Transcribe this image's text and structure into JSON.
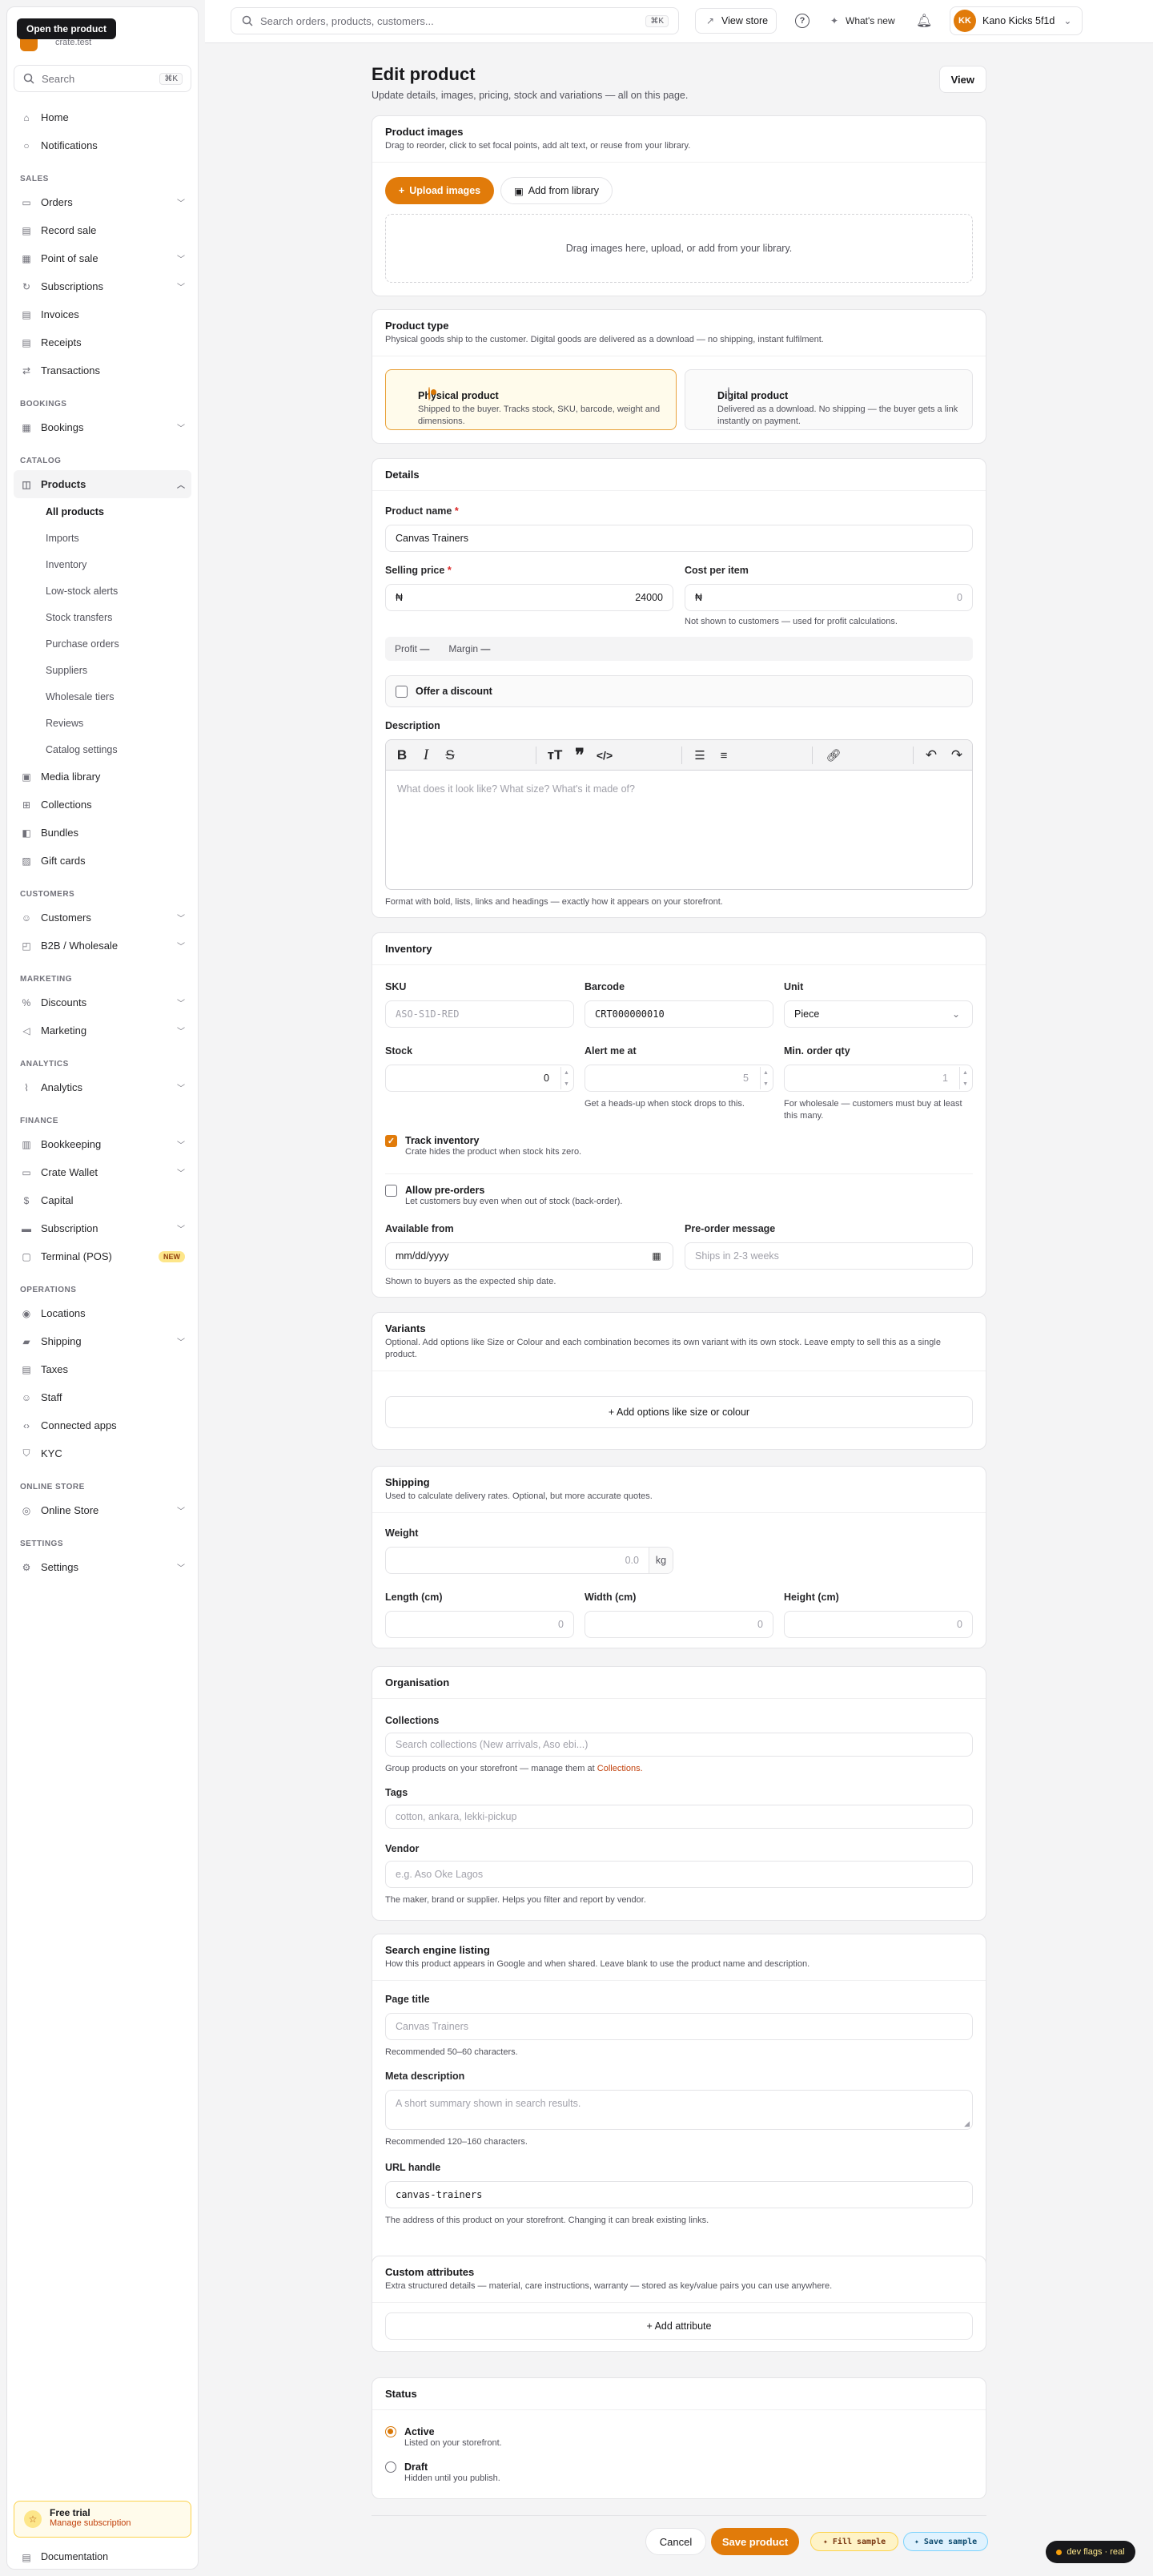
{
  "tooltip": "Open the product",
  "brand": {
    "subtitle": "crate.test"
  },
  "sidebar": {
    "search": {
      "placeholder": "Search",
      "shortcut": "⌘K"
    },
    "groups": [
      {
        "section": "",
        "items": [
          {
            "label": "Home",
            "icon": "home-icon"
          },
          {
            "label": "Notifications",
            "icon": "bell-icon"
          }
        ]
      },
      {
        "section": "SALES",
        "items": [
          {
            "label": "Orders",
            "icon": "orders-icon",
            "chevron": true
          },
          {
            "label": "Record sale",
            "icon": "receipt-icon"
          },
          {
            "label": "Point of sale",
            "icon": "pos-icon",
            "chevron": true
          },
          {
            "label": "Subscriptions",
            "icon": "repeat-icon",
            "chevron": true
          },
          {
            "label": "Invoices",
            "icon": "invoice-icon"
          },
          {
            "label": "Receipts",
            "icon": "receipt-icon"
          },
          {
            "label": "Transactions",
            "icon": "swap-icon"
          }
        ]
      },
      {
        "section": "BOOKINGS",
        "items": [
          {
            "label": "Bookings",
            "icon": "calendar-icon",
            "chevron": true
          }
        ]
      },
      {
        "section": "CATALOG",
        "items": [
          {
            "label": "Products",
            "icon": "box-icon",
            "chevron": true,
            "active": true
          }
        ]
      }
    ],
    "products_sub": [
      "All products",
      "Imports",
      "Inventory",
      "Low-stock alerts",
      "Stock transfers",
      "Purchase orders",
      "Suppliers",
      "Wholesale tiers",
      "Reviews",
      "Catalog settings"
    ],
    "groups2": [
      {
        "section": "",
        "items": [
          {
            "label": "Media library",
            "icon": "image-icon"
          },
          {
            "label": "Collections",
            "icon": "grid-icon"
          },
          {
            "label": "Bundles",
            "icon": "bundle-icon"
          },
          {
            "label": "Gift cards",
            "icon": "gift-icon"
          }
        ]
      },
      {
        "section": "CUSTOMERS",
        "items": [
          {
            "label": "Customers",
            "icon": "users-icon",
            "chevron": true
          },
          {
            "label": "B2B / Wholesale",
            "icon": "briefcase-icon",
            "chevron": true
          }
        ]
      },
      {
        "section": "MARKETING",
        "items": [
          {
            "label": "Discounts",
            "icon": "percent-icon",
            "chevron": true
          },
          {
            "label": "Marketing",
            "icon": "megaphone-icon",
            "chevron": true
          }
        ]
      },
      {
        "section": "ANALYTICS",
        "items": [
          {
            "label": "Analytics",
            "icon": "chart-icon",
            "chevron": true
          }
        ]
      },
      {
        "section": "FINANCE",
        "items": [
          {
            "label": "Bookkeeping",
            "icon": "book-icon",
            "chevron": true
          },
          {
            "label": "Crate Wallet",
            "icon": "wallet-icon",
            "chevron": true
          },
          {
            "label": "Capital",
            "icon": "dollar-icon"
          },
          {
            "label": "Subscription",
            "icon": "card-icon",
            "chevron": true
          },
          {
            "label": "Terminal (POS)",
            "icon": "terminal-icon",
            "badge": "NEW"
          }
        ]
      },
      {
        "section": "OPERATIONS",
        "items": [
          {
            "label": "Locations",
            "icon": "pin-icon"
          },
          {
            "label": "Shipping",
            "icon": "truck-icon",
            "chevron": true
          },
          {
            "label": "Taxes",
            "icon": "tax-icon"
          },
          {
            "label": "Staff",
            "icon": "staff-icon"
          },
          {
            "label": "Connected apps",
            "icon": "code-icon"
          },
          {
            "label": "KYC",
            "icon": "shield-icon"
          }
        ]
      },
      {
        "section": "ONLINE STORE",
        "items": [
          {
            "label": "Online Store",
            "icon": "globe-icon",
            "chevron": true
          }
        ]
      },
      {
        "section": "SETTINGS",
        "items": [
          {
            "label": "Settings",
            "icon": "gear-icon",
            "chevron": true
          }
        ]
      }
    ],
    "trial": {
      "title": "Free trial",
      "link": "Manage subscription"
    },
    "docs": "Documentation"
  },
  "topbar": {
    "search_placeholder": "Search orders, products, customers...",
    "search_shortcut": "⌘K",
    "view_store": "View store",
    "whats_new": "What's new",
    "store": {
      "initials": "KK",
      "name": "Kano Kicks 5f1d"
    }
  },
  "page": {
    "title": "Edit product",
    "subtitle": "Update details, images, pricing, stock and variations — all on this page.",
    "view_button": "View"
  },
  "images": {
    "title": "Product images",
    "desc": "Drag to reorder, click to set focal points, add alt text, or reuse from your library.",
    "upload": "Upload images",
    "library": "Add from library",
    "dropzone": "Drag images here, upload, or add from your library."
  },
  "product_type": {
    "title": "Product type",
    "desc": "Physical goods ship to the customer. Digital goods are delivered as a download — no shipping, instant fulfilment.",
    "physical": {
      "title": "Physical product",
      "desc": "Shipped to the buyer. Tracks stock, SKU, barcode, weight and dimensions."
    },
    "digital": {
      "title": "Digital product",
      "desc": "Delivered as a download. No shipping — the buyer gets a link instantly on payment."
    }
  },
  "details": {
    "title": "Details",
    "name_label": "Product name",
    "name_value": "Canvas Trainers",
    "price_label": "Selling price",
    "currency": "₦",
    "price_value": "24000",
    "cost_label": "Cost per item",
    "cost_placeholder": "0",
    "cost_hint": "Not shown to customers — used for profit calculations.",
    "profit_label": "Profit",
    "profit_value": "—",
    "margin_label": "Margin",
    "margin_value": "—",
    "discount_label": "Offer a discount",
    "desc_label": "Description",
    "desc_placeholder": "What does it look like? What size? What's it made of?",
    "desc_hint": "Format with bold, lists, links and headings — exactly how it appears on your storefront."
  },
  "inventory": {
    "title": "Inventory",
    "sku_label": "SKU",
    "sku_placeholder": "ASO-S1D-RED",
    "barcode_label": "Barcode",
    "barcode_value": "CRT000000010",
    "unit_label": "Unit",
    "unit_value": "Piece",
    "stock_label": "Stock",
    "stock_value": "0",
    "alert_label": "Alert me at",
    "alert_placeholder": "5",
    "alert_hint": "Get a heads-up when stock drops to this.",
    "min_label": "Min. order qty",
    "min_placeholder": "1",
    "min_hint": "For wholesale — customers must buy at least this many.",
    "track_title": "Track inventory",
    "track_desc": "Crate hides the product when stock hits zero.",
    "preorder_title": "Allow pre-orders",
    "preorder_desc": "Let customers buy even when out of stock (back-order).",
    "available_label": "Available from",
    "available_placeholder": "mm/dd/yyyy",
    "available_hint": "Shown to buyers as the expected ship date.",
    "preorder_msg_label": "Pre-order message",
    "preorder_msg_placeholder": "Ships in 2-3 weeks"
  },
  "variants": {
    "title": "Variants",
    "desc": "Optional. Add options like Size or Colour and each combination becomes its own variant with its own stock. Leave empty to sell this as a single product.",
    "add": "+ Add options like size or colour"
  },
  "shipping": {
    "title": "Shipping",
    "desc": "Used to calculate delivery rates. Optional, but more accurate quotes.",
    "weight_label": "Weight",
    "weight_placeholder": "0.0",
    "weight_unit": "kg",
    "length_label": "Length (cm)",
    "width_label": "Width (cm)",
    "height_label": "Height (cm)",
    "dim_placeholder": "0"
  },
  "organisation": {
    "title": "Organisation",
    "collections_label": "Collections",
    "collections_placeholder": "Search collections (New arrivals, Aso ebi...)",
    "collections_hint": "Group products on your storefront — manage them at",
    "collections_link": "Collections.",
    "tags_label": "Tags",
    "tags_placeholder": "cotton, ankara, lekki-pickup",
    "vendor_label": "Vendor",
    "vendor_placeholder": "e.g. Aso Oke Lagos",
    "vendor_hint": "The maker, brand or supplier. Helps you filter and report by vendor."
  },
  "seo": {
    "title": "Search engine listing",
    "desc": "How this product appears in Google and when shared. Leave blank to use the product name and description.",
    "page_title_label": "Page title",
    "page_title_placeholder": "Canvas Trainers",
    "page_title_hint": "Recommended 50–60 characters.",
    "meta_label": "Meta description",
    "meta_placeholder": "A short summary shown in search results.",
    "meta_hint": "Recommended 120–160 characters.",
    "url_label": "URL handle",
    "url_value": "canvas-trainers",
    "url_hint": "The address of this product on your storefront. Changing it can break existing links."
  },
  "attributes": {
    "title": "Custom attributes",
    "desc": "Extra structured details — material, care instructions, warranty — stored as key/value pairs you can use anywhere.",
    "add": "+ Add attribute"
  },
  "status": {
    "title": "Status",
    "active_title": "Active",
    "active_desc": "Listed on your storefront.",
    "draft_title": "Draft",
    "draft_desc": "Hidden until you publish."
  },
  "footer": {
    "cancel": "Cancel",
    "save": "Save product",
    "fill_sample": "✦ Fill sample",
    "save_sample": "✦ Save sample",
    "dev_flags": "dev flags · real"
  }
}
